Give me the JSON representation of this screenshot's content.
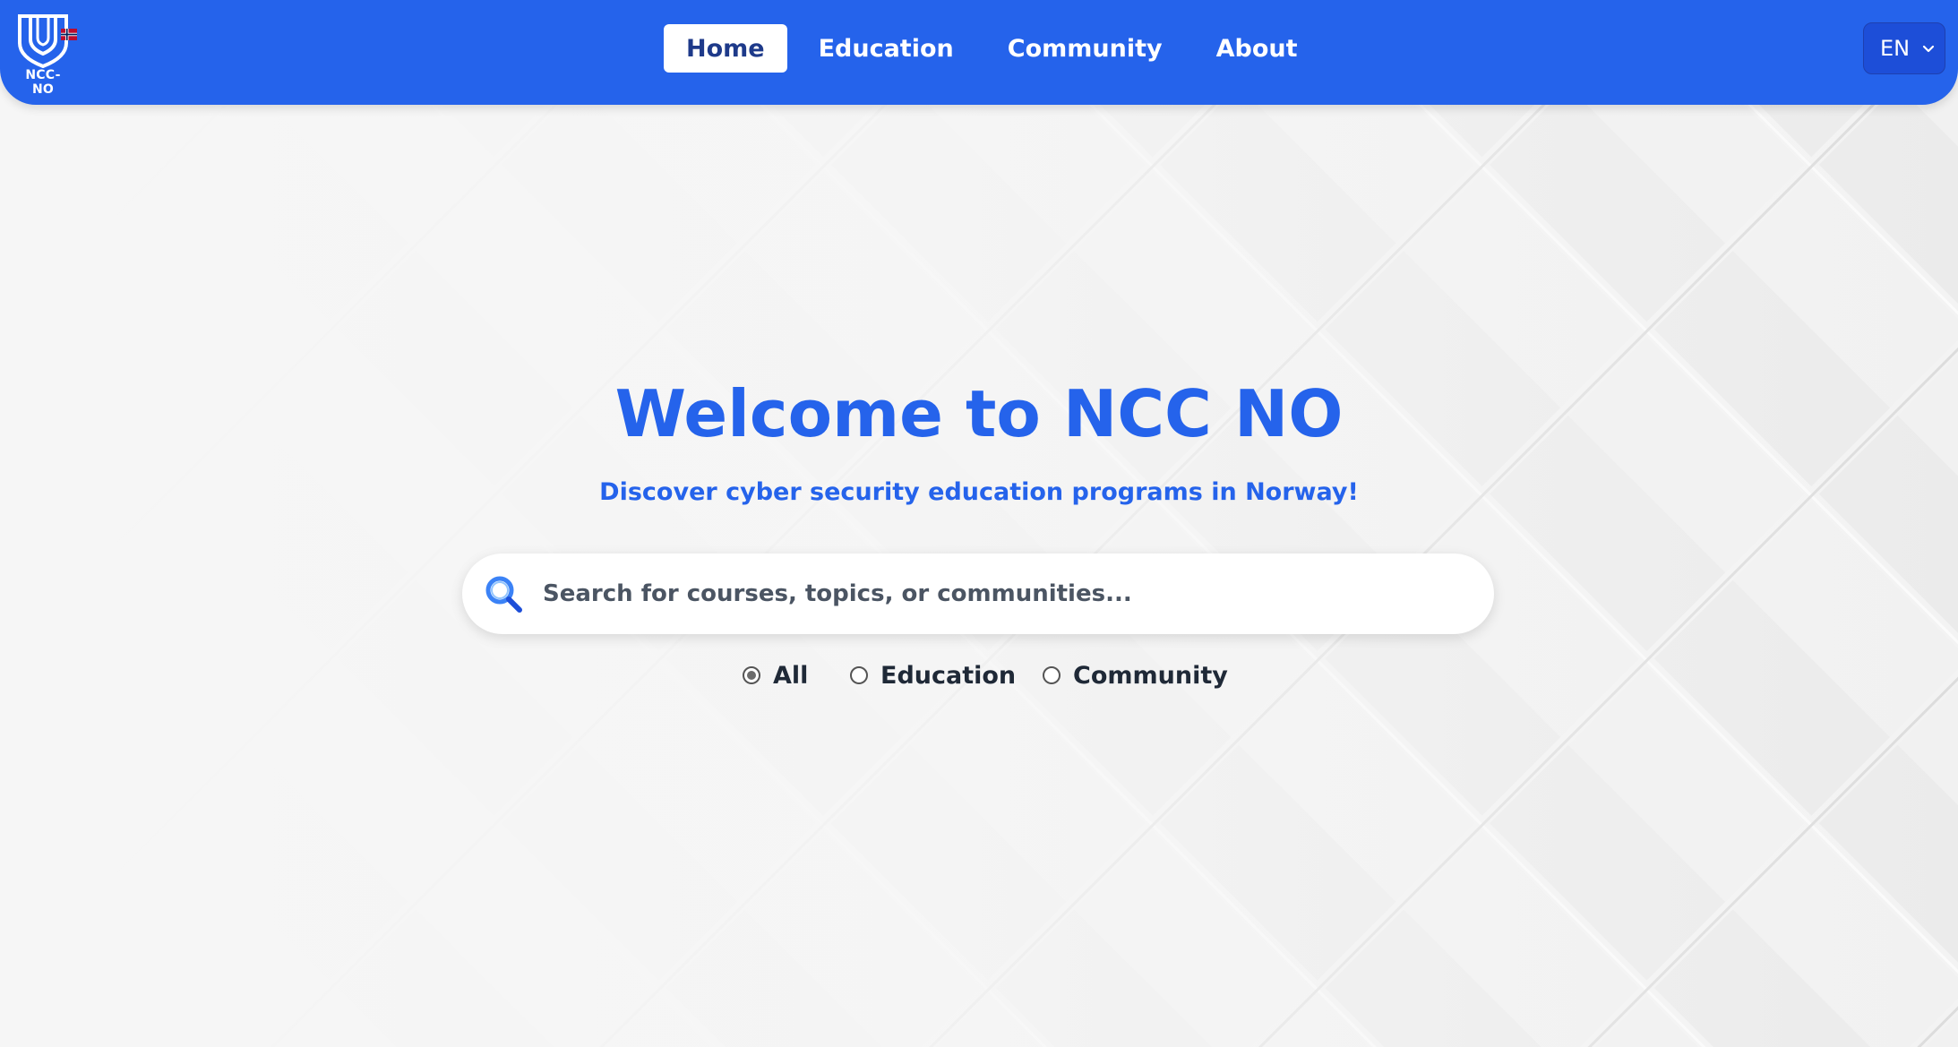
{
  "header": {
    "logo_text": "NCC-NO",
    "nav": [
      {
        "label": "Home",
        "active": true
      },
      {
        "label": "Education",
        "active": false
      },
      {
        "label": "Community",
        "active": false
      },
      {
        "label": "About",
        "active": false
      }
    ],
    "language": {
      "selected": "EN"
    }
  },
  "hero": {
    "title": "Welcome to NCC NO",
    "subtitle": "Discover cyber security education programs in Norway!"
  },
  "search": {
    "placeholder": "Search for courses, topics, or communities...",
    "value": ""
  },
  "filters": [
    {
      "label": "All",
      "checked": true
    },
    {
      "label": "Education",
      "checked": false
    },
    {
      "label": "Community",
      "checked": false
    }
  ],
  "colors": {
    "brand": "#2563eb",
    "nav_active_text": "#1e3a8a",
    "background": "#f6f6f6"
  }
}
